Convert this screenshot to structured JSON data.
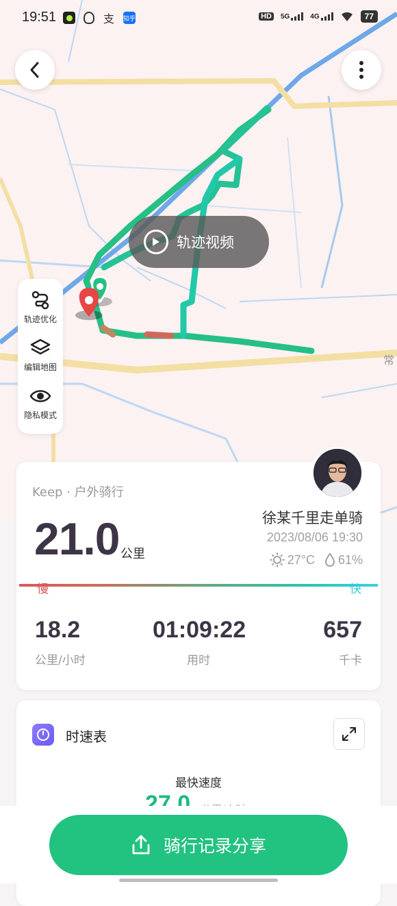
{
  "status_bar": {
    "time": "19:51",
    "left_icons": [
      "app-icon",
      "qq-icon",
      "alipay-icon",
      "zhihu-icon"
    ],
    "alipay_glyph": "支",
    "zhihu_glyph": "知乎",
    "right": {
      "hd": "HD",
      "signal1": "5G",
      "signal2": "4G",
      "battery": "77"
    }
  },
  "map": {
    "video_button_label": "轨迹视频",
    "road_label": "常",
    "tools": [
      {
        "label": "轨迹优化",
        "icon": "route-icon"
      },
      {
        "label": "编辑地图",
        "icon": "layers-icon"
      },
      {
        "label": "隐私模式",
        "icon": "eye-icon"
      }
    ]
  },
  "summary": {
    "source": "Keep · 户外骑行",
    "title": "徐某千里走单骑",
    "datetime": "2023/08/06 19:30",
    "temperature": "27°C",
    "humidity": "61%",
    "distance": "21.0",
    "distance_unit": "公里",
    "speed_scale": {
      "slow": "慢",
      "fast": "快"
    },
    "stats": [
      {
        "value": "18.2",
        "label": "公里/小时"
      },
      {
        "value": "01:09:22",
        "label": "用时"
      },
      {
        "value": "657",
        "label": "千卡"
      }
    ]
  },
  "speedometer": {
    "title": "时速表",
    "max_speed_label": "最快速度",
    "max_speed_value": "27.0",
    "max_speed_unit": "公里/小时"
  },
  "share_button": {
    "label": "骑行记录分享"
  },
  "colors": {
    "accent": "#22c281",
    "route": "#2bc48f",
    "slow": "#d65a58",
    "fast": "#36d3e3"
  }
}
